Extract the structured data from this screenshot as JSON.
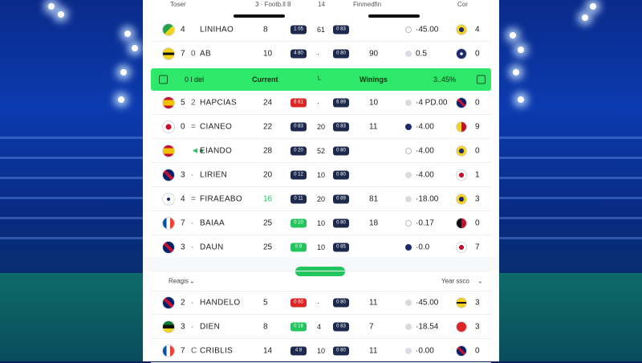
{
  "colors": {
    "accent": "#2ee86a",
    "navy": "#1d2a4d",
    "red": "#dc2626",
    "green": "#22c55e"
  },
  "topbar": {
    "left": "Toser",
    "center": "3 · Footb.ll 8",
    "mid_right": "14",
    "right_center": "Finmedfin",
    "right": "Cor"
  },
  "header": {
    "col1": "0 l del",
    "col2": "Current",
    "col3": "Winings",
    "col4": "3..45%"
  },
  "rows_top": [
    {
      "flag": "flag-green-yellow",
      "pos": "4",
      "move": "",
      "name": "LINIHAO",
      "num1": "8",
      "pillA": "1 05",
      "mid": "61",
      "pillB": "0 83",
      "num2": "",
      "dot": "ring",
      "win": "·45.00",
      "flag2": "flag-yellow-navy",
      "num3": "4"
    },
    {
      "flag": "flag-yellow-black",
      "pos": "7",
      "move": "0",
      "name": "AB",
      "num1": "10",
      "pillA": "4 80",
      "mid": "·",
      "pillB": "0 80",
      "num2": "90",
      "dot": "",
      "win": "0.5",
      "flag2": "flag-navy",
      "num3": "0"
    }
  ],
  "rows_main": [
    {
      "flag": "flag-spain",
      "pos": "5",
      "move": "2",
      "name": "HAPCIAS",
      "num1": "24",
      "pillA": "6 81",
      "mid": "·",
      "pillB": "6 89",
      "num2": "10",
      "dot": "",
      "win": "·4 PD.00",
      "flag2": "flag-uk",
      "num3": "0"
    },
    {
      "flag": "flag-red-white",
      "pos": "0",
      "move": "=",
      "name": "CIANEO",
      "num1": "22",
      "pillA": "0 83",
      "mid": "20",
      "pillB": "0 83",
      "num2": "11",
      "dot": "navy",
      "win": "·4.00",
      "flag2": "flag-yellow-red",
      "num3": "9"
    },
    {
      "flag": "flag-spain",
      "pos": "",
      "move": "◄●",
      "name": "EIANDO",
      "num1": "28",
      "pillA": "0 20",
      "mid": "52",
      "pillB": "0 80",
      "num2": "",
      "dot": "ring",
      "win": "·4.00",
      "flag2": "flag-yellow-navy",
      "num3": "0"
    },
    {
      "flag": "flag-uk",
      "pos": "3",
      "move": "·",
      "name": "LIRIEN",
      "num1": "20",
      "pillA": "0 12",
      "mid": "10",
      "pillB": "0 80",
      "num2": "",
      "dot": "",
      "win": "·4.00",
      "flag2": "flag-red-white",
      "num3": "1"
    },
    {
      "flag": "flag-white",
      "pos": "4",
      "move": "=",
      "name": "FIRAEABO",
      "num1": "16",
      "pillA": "0 11",
      "mid": "20",
      "pillB": "0 89",
      "num2": "81",
      "dot": "",
      "win": "·18.00",
      "flag2": "flag-yellow-navy",
      "num3": "3"
    },
    {
      "flag": "flag-france",
      "pos": "7",
      "move": "·",
      "name": "BAIAA",
      "num1": "25",
      "pillA": "0 10",
      "mid": "10",
      "pillB": "0 80",
      "num2": "18",
      "dot": "ring",
      "win": "·0.17",
      "flag2": "flag-black-red",
      "num3": "0"
    },
    {
      "flag": "flag-uk",
      "pos": "3",
      "move": "·",
      "name": "DAUN",
      "num1": "25",
      "pillA": "0 8",
      "mid": "10",
      "pillB": "0 85",
      "num2": "",
      "dot": "navy",
      "win": "·0.0",
      "flag2": "flag-red-white",
      "num3": "7"
    }
  ],
  "divider": {
    "label": "·· ·· ··"
  },
  "filter": {
    "left": "Reagis",
    "right": "Year ssco"
  },
  "rows_bottom": [
    {
      "flag": "flag-uk",
      "pos": "2",
      "move": "·",
      "name": "HANDELO",
      "num1": "5",
      "pillA": "0 60",
      "mid": "·",
      "pillB": "0 80",
      "num2": "11",
      "dot": "",
      "win": "·45.00",
      "flag2": "flag-yellow-black",
      "num3": "3"
    },
    {
      "flag": "flag-green-black",
      "pos": "3",
      "move": "·",
      "name": "DIEN",
      "num1": "8",
      "pillA": "0 18",
      "mid": "4",
      "pillB": "0 83",
      "num2": "7",
      "dot": "",
      "win": "·18.54",
      "flag2": "flag-red",
      "num3": "3"
    },
    {
      "flag": "flag-france",
      "pos": "7",
      "move": "C",
      "name": "CRIBLIS",
      "num1": "14",
      "pillA": "4 8",
      "mid": "10",
      "pillB": "0 80",
      "num2": "11",
      "dot": "",
      "win": "·0.00",
      "flag2": "flag-uk",
      "num3": "0"
    }
  ]
}
